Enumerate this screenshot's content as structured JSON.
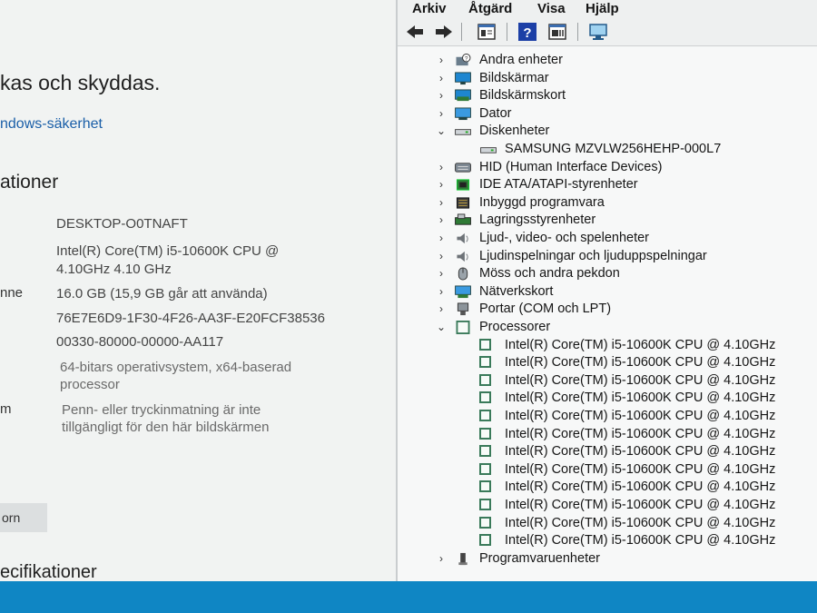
{
  "settings": {
    "protect_heading": "kas och skyddas.",
    "security_link": "ndows-säkerhet",
    "section_heading": "ationer",
    "labels": {
      "memory": "nne",
      "pen": "m"
    },
    "device_name": "DESKTOP-O0TNAFT",
    "processor_line1": "Intel(R) Core(TM) i5-10600K CPU @",
    "processor_line2": "4.10GHz   4.10 GHz",
    "ram": "16.0 GB (15,9 GB går att använda)",
    "device_id": "76E7E6D9-1F30-4F26-AA3F-E20FCF38536",
    "product_id": "00330-80000-00000-AA117",
    "system_type_line1": "64-bitars operativsystem, x64-baserad",
    "system_type_line2": "processor",
    "pen_line1": "Penn- eller tryckinmatning är inte",
    "pen_line2": "tillgängligt för den här bildskärmen",
    "rename_button": "orn",
    "windows_heading": "ecifikationer"
  },
  "devmgr": {
    "menu": [
      "Arkiv",
      "Åtgärd",
      "Visa",
      "Hjälp"
    ],
    "toolbar_icons": [
      "back-arrow-icon",
      "forward-arrow-icon",
      "properties-icon",
      "help-icon",
      "update-driver-icon",
      "scan-hardware-icon"
    ],
    "tree": [
      {
        "label": "Andra enheter",
        "icon": "unknown-device-icon",
        "expanded": false
      },
      {
        "label": "Bildskärmar",
        "icon": "monitor-icon",
        "expanded": false
      },
      {
        "label": "Bildskärmskort",
        "icon": "display-adapter-icon",
        "expanded": false
      },
      {
        "label": "Dator",
        "icon": "computer-icon",
        "expanded": false
      },
      {
        "label": "Diskenheter",
        "icon": "disk-drive-icon",
        "expanded": true
      },
      {
        "label": "SAMSUNG MZVLW256HEHP-000L7",
        "icon": "disk-icon",
        "child": true
      },
      {
        "label": "HID (Human Interface Devices)",
        "icon": "hid-icon",
        "expanded": false
      },
      {
        "label": "IDE ATA/ATAPI-styrenheter",
        "icon": "ide-controller-icon",
        "expanded": false
      },
      {
        "label": "Inbyggd programvara",
        "icon": "firmware-icon",
        "expanded": false
      },
      {
        "label": "Lagringsstyrenheter",
        "icon": "storage-controller-icon",
        "expanded": false
      },
      {
        "label": "Ljud-, video- och spelenheter",
        "icon": "speaker-icon",
        "expanded": false
      },
      {
        "label": "Ljudinspelningar och ljuduppspelningar",
        "icon": "audio-io-icon",
        "expanded": false
      },
      {
        "label": "Möss och andra pekdon",
        "icon": "mouse-icon",
        "expanded": false
      },
      {
        "label": "Nätverkskort",
        "icon": "network-adapter-icon",
        "expanded": false
      },
      {
        "label": "Portar (COM och LPT)",
        "icon": "port-icon",
        "expanded": false
      },
      {
        "label": "Processorer",
        "icon": "processor-icon",
        "expanded": true
      },
      {
        "label": "Intel(R) Core(TM) i5-10600K CPU @ 4.10GHz",
        "icon": "cpu-icon",
        "child": true
      },
      {
        "label": "Intel(R) Core(TM) i5-10600K CPU @ 4.10GHz",
        "icon": "cpu-icon",
        "child": true
      },
      {
        "label": "Intel(R) Core(TM) i5-10600K CPU @ 4.10GHz",
        "icon": "cpu-icon",
        "child": true
      },
      {
        "label": "Intel(R) Core(TM) i5-10600K CPU @ 4.10GHz",
        "icon": "cpu-icon",
        "child": true
      },
      {
        "label": "Intel(R) Core(TM) i5-10600K CPU @ 4.10GHz",
        "icon": "cpu-icon",
        "child": true
      },
      {
        "label": "Intel(R) Core(TM) i5-10600K CPU @ 4.10GHz",
        "icon": "cpu-icon",
        "child": true
      },
      {
        "label": "Intel(R) Core(TM) i5-10600K CPU @ 4.10GHz",
        "icon": "cpu-icon",
        "child": true
      },
      {
        "label": "Intel(R) Core(TM) i5-10600K CPU @ 4.10GHz",
        "icon": "cpu-icon",
        "child": true
      },
      {
        "label": "Intel(R) Core(TM) i5-10600K CPU @ 4.10GHz",
        "icon": "cpu-icon",
        "child": true
      },
      {
        "label": "Intel(R) Core(TM) i5-10600K CPU @ 4.10GHz",
        "icon": "cpu-icon",
        "child": true
      },
      {
        "label": "Intel(R) Core(TM) i5-10600K CPU @ 4.10GHz",
        "icon": "cpu-icon",
        "child": true
      },
      {
        "label": "Intel(R) Core(TM) i5-10600K CPU @ 4.10GHz",
        "icon": "cpu-icon",
        "child": true
      },
      {
        "label": "Programvaruenheter",
        "icon": "software-device-icon",
        "expanded": false
      }
    ]
  },
  "colors": {
    "link": "#1b5fa8",
    "taskbar": "#0f86c4",
    "cpu_icon": "#3a7a5a"
  }
}
